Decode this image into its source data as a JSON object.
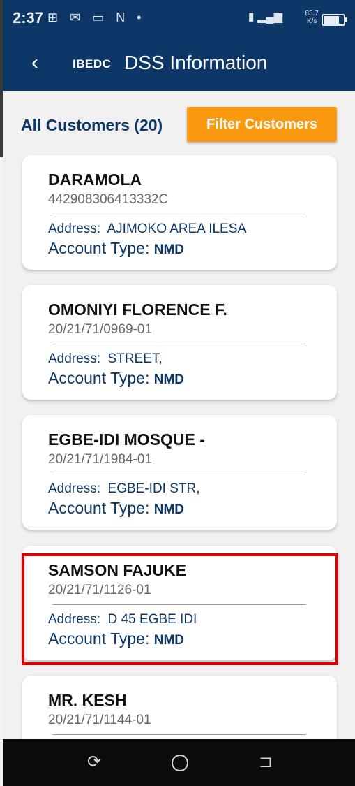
{
  "status_bar": {
    "time": "2:37",
    "left_icons": "⊞ ✉ ▭ N •",
    "speed_top": "83.7",
    "speed_bottom": "K/s",
    "right_icons": "▮ ▂▄▆"
  },
  "app_bar": {
    "back_icon": "‹",
    "brand": "IBEDC",
    "title": "DSS Information"
  },
  "header": {
    "count_label": "All Customers (20)",
    "filter_button": "Filter Customers"
  },
  "labels": {
    "address": "Address:  ",
    "account_type": "Account Type: "
  },
  "customers": [
    {
      "name": "DARAMOLA",
      "account": "442908306413332C",
      "address": "AJIMOKO AREA ILESA",
      "account_type": "NMD"
    },
    {
      "name": "OMONIYI FLORENCE F.",
      "account": "20/21/71/0969-01",
      "address": "STREET,",
      "account_type": "NMD"
    },
    {
      "name": "EGBE-IDI MOSQUE -",
      "account": "20/21/71/1984-01",
      "address": "EGBE-IDI STR,",
      "account_type": "NMD"
    },
    {
      "name": "SAMSON FAJUKE",
      "account": "20/21/71/1126-01",
      "address": "D 45 EGBE IDI",
      "account_type": "NMD"
    },
    {
      "name": "MR. KESH",
      "account": "20/21/71/1144-01",
      "address": "",
      "account_type": ""
    }
  ],
  "nav": {
    "recents_icon": "⟳",
    "back_icon": "⊐"
  },
  "colors": {
    "primary": "#0c3766",
    "accent": "#fb9a10",
    "highlight": "#e00000"
  }
}
